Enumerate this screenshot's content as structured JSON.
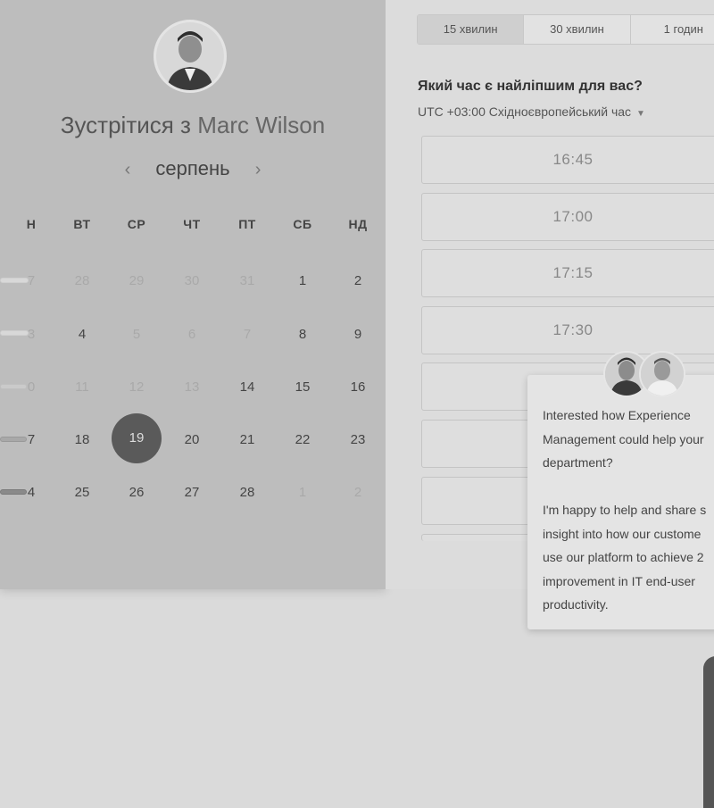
{
  "calendar": {
    "title_prefix": "Зустрітися з",
    "host_name": "Marc Wilson",
    "month": "серпень",
    "prev_arrow": "‹",
    "next_arrow": "›",
    "weekdays": [
      "Н",
      "ВТ",
      "СР",
      "ЧТ",
      "ПТ",
      "СБ",
      "НД"
    ],
    "weeks": [
      [
        "7",
        "28",
        "29",
        "30",
        "31",
        "1",
        "2"
      ],
      [
        "3",
        "4",
        "5",
        "6",
        "7",
        "8",
        "9"
      ],
      [
        "0",
        "11",
        "12",
        "13",
        "14",
        "15",
        "16"
      ],
      [
        "7",
        "18",
        "19",
        "20",
        "21",
        "22",
        "23"
      ],
      [
        "4",
        "25",
        "26",
        "27",
        "28",
        "1",
        "2"
      ]
    ],
    "selected_day": "19"
  },
  "durations": [
    "15 хвилин",
    "30 хвилин",
    "1 годин"
  ],
  "scheduler": {
    "question": "Який час є найліпшим для вас?",
    "timezone": "UTC +03:00 Східноєвропейський час",
    "slots": [
      "16:45",
      "17:00",
      "17:15",
      "17:30",
      "",
      "",
      ""
    ]
  },
  "chat": {
    "message": "Interested how Experience\nManagement could help your\ndepartment?\n\nI'm happy to help and share s\ninsight into how our custome\nuse our platform to achieve 2\nimprovement in IT end-user\nproductivity."
  }
}
